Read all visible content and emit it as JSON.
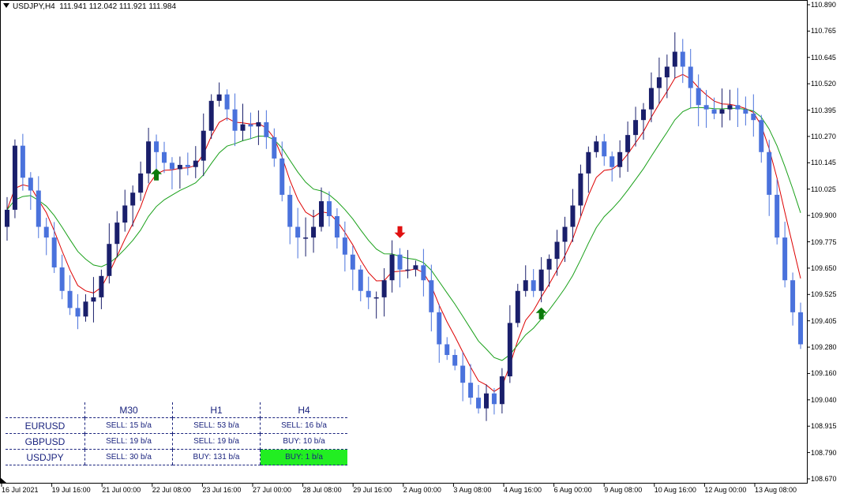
{
  "header": {
    "symbol": "USDJPY,H4",
    "ohlc": "111.941 112.042 111.921 111.984"
  },
  "colors": {
    "bull": "#1a1f6b",
    "bear": "#4a72dc",
    "ma_fast": "#dd0000",
    "ma_slow": "#19a019",
    "arrow_up": "#0b7a0b",
    "arrow_down": "#e01010",
    "highlight": "#22ee22"
  },
  "y_axis": {
    "min": 108.67,
    "max": 110.89,
    "labels": [
      "110.890",
      "110.765",
      "110.645",
      "110.520",
      "110.395",
      "110.270",
      "110.145",
      "110.025",
      "109.900",
      "109.775",
      "109.650",
      "109.525",
      "109.405",
      "109.280",
      "109.160",
      "109.040",
      "108.915",
      "108.790",
      "108.670"
    ]
  },
  "x_axis": {
    "labels": [
      "16 Jul 2021",
      "19 Jul 16:00",
      "21 Jul 00:00",
      "22 Jul 08:00",
      "23 Jul 16:00",
      "27 Jul 00:00",
      "28 Jul 08:00",
      "29 Jul 16:00",
      "2 Aug 00:00",
      "3 Aug 08:00",
      "4 Aug 16:00",
      "6 Aug 00:00",
      "9 Aug 08:00",
      "10 Aug 16:00",
      "12 Aug 00:00",
      "13 Aug 08:00"
    ]
  },
  "signal_table": {
    "timeframes": [
      "M30",
      "H1",
      "H4"
    ],
    "rows": [
      {
        "pair": "EURUSD",
        "m30": "SELL: 15 b/a",
        "h1": "SELL: 53 b/a",
        "h4": "SELL: 16 b/a"
      },
      {
        "pair": "GBPUSD",
        "m30": "SELL: 19 b/a",
        "h1": "SELL: 19 b/a",
        "h4": "BUY: 10 b/a"
      },
      {
        "pair": "USDJPY",
        "m30": "SELL: 30 b/a",
        "h1": "BUY: 131 b/a",
        "h4": "BUY: 1 b/a"
      }
    ]
  },
  "chart_data": {
    "type": "candlestick",
    "symbol": "USDJPY",
    "timeframe": "H4",
    "ylim": [
      108.67,
      110.89
    ],
    "closes": [
      109.93,
      110.23,
      110.08,
      110.02,
      109.85,
      109.8,
      109.66,
      109.55,
      109.47,
      109.43,
      109.5,
      109.52,
      109.62,
      109.77,
      109.87,
      109.95,
      110.01,
      110.1,
      110.25,
      110.2,
      110.15,
      110.12,
      110.14,
      110.13,
      110.16,
      110.3,
      110.44,
      110.47,
      110.4,
      110.3,
      110.33,
      110.32,
      110.34,
      110.27,
      110.17,
      110.0,
      109.85,
      109.8,
      109.8,
      109.85,
      109.97,
      109.9,
      109.8,
      109.72,
      109.65,
      109.55,
      109.52,
      109.52,
      109.6,
      109.72,
      109.65,
      109.65,
      109.67,
      109.6,
      109.45,
      109.3,
      109.25,
      109.2,
      109.12,
      109.05,
      109.0,
      109.07,
      109.02,
      109.15,
      109.4,
      109.55,
      109.6,
      109.55,
      109.65,
      109.7,
      109.78,
      109.85,
      109.95,
      110.1,
      110.2,
      110.25,
      110.18,
      110.13,
      110.2,
      110.28,
      110.35,
      110.4,
      110.5,
      110.55,
      110.6,
      110.67,
      110.6,
      110.5,
      110.42,
      110.4,
      110.38,
      110.4,
      110.42,
      110.4,
      110.38,
      110.35,
      110.2,
      110.0,
      109.8,
      109.6,
      109.45,
      109.3
    ],
    "moving_averages": [
      "red fast MA",
      "green slow MA"
    ],
    "signals": [
      {
        "type": "buy",
        "bar": 30
      },
      {
        "type": "sell",
        "bar": 79
      },
      {
        "type": "buy",
        "bar": 107
      }
    ]
  }
}
